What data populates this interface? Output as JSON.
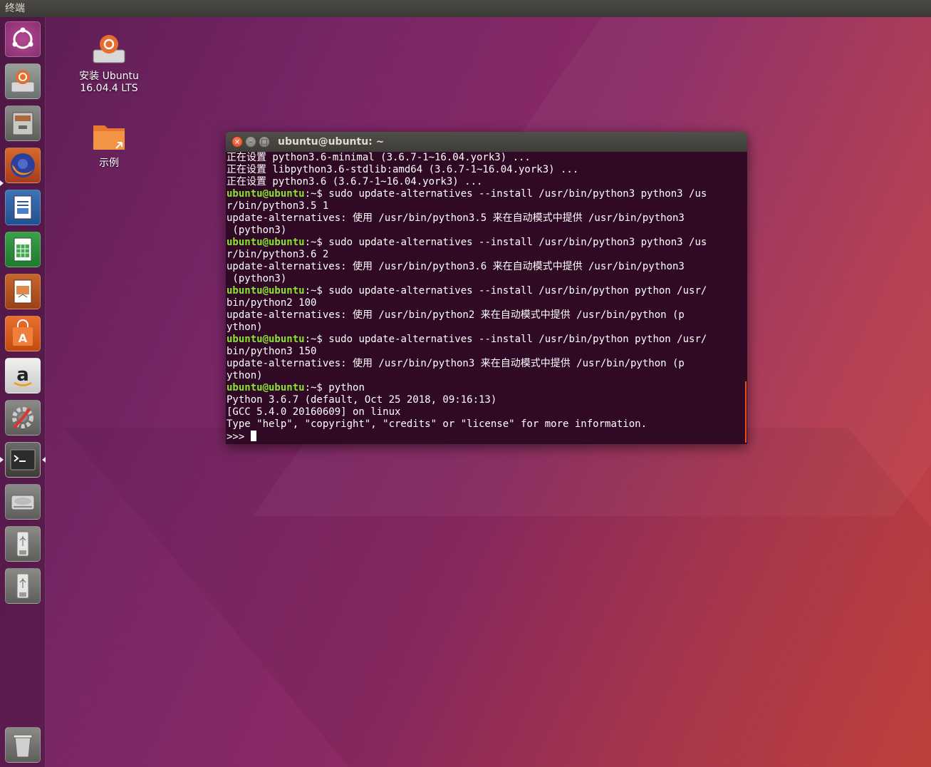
{
  "top_panel": {
    "title": "终端"
  },
  "launcher": {
    "items": [
      {
        "name": "dash"
      },
      {
        "name": "install-ubuntu"
      },
      {
        "name": "files"
      },
      {
        "name": "firefox"
      },
      {
        "name": "libreoffice-writer"
      },
      {
        "name": "libreoffice-calc"
      },
      {
        "name": "libreoffice-impress"
      },
      {
        "name": "ubuntu-software"
      },
      {
        "name": "amazon"
      },
      {
        "name": "system-settings"
      },
      {
        "name": "terminal"
      },
      {
        "name": "disk-drive"
      },
      {
        "name": "usb-drive-1"
      },
      {
        "name": "usb-drive-2"
      },
      {
        "name": "trash"
      }
    ]
  },
  "desktop": {
    "install_icon": {
      "label_line1": "安装 Ubuntu",
      "label_line2": "16.04.4 LTS"
    },
    "examples_icon": {
      "label": "示例"
    }
  },
  "terminal": {
    "title": "ubuntu@ubuntu: ~",
    "prompt": "ubuntu@ubuntu",
    "prompt_suffix": ":~$ ",
    "lines": [
      {
        "text": "正在设置 python3.6-minimal (3.6.7-1~16.04.york3) ..."
      },
      {
        "text": "正在设置 libpython3.6-stdlib:amd64 (3.6.7-1~16.04.york3) ..."
      },
      {
        "text": "正在设置 python3.6 (3.6.7-1~16.04.york3) ..."
      },
      {
        "prompt": true,
        "text": "sudo update-alternatives --install /usr/bin/python3 python3 /us"
      },
      {
        "text": "r/bin/python3.5 1"
      },
      {
        "text": "update-alternatives: 使用 /usr/bin/python3.5 来在自动模式中提供 /usr/bin/python3"
      },
      {
        "text": " (python3)"
      },
      {
        "prompt": true,
        "text": "sudo update-alternatives --install /usr/bin/python3 python3 /us"
      },
      {
        "text": "r/bin/python3.6 2"
      },
      {
        "text": "update-alternatives: 使用 /usr/bin/python3.6 来在自动模式中提供 /usr/bin/python3"
      },
      {
        "text": " (python3)"
      },
      {
        "prompt": true,
        "text": "sudo update-alternatives --install /usr/bin/python python /usr/"
      },
      {
        "text": "bin/python2 100"
      },
      {
        "text": "update-alternatives: 使用 /usr/bin/python2 来在自动模式中提供 /usr/bin/python (p"
      },
      {
        "text": "ython)"
      },
      {
        "prompt": true,
        "text": "sudo update-alternatives --install /usr/bin/python python /usr/"
      },
      {
        "text": "bin/python3 150"
      },
      {
        "text": "update-alternatives: 使用 /usr/bin/python3 来在自动模式中提供 /usr/bin/python (p"
      },
      {
        "text": "ython)"
      },
      {
        "prompt": true,
        "text": "python"
      },
      {
        "text": "Python 3.6.7 (default, Oct 25 2018, 09:16:13)"
      },
      {
        "text": "[GCC 5.4.0 20160609] on linux"
      },
      {
        "text": "Type \"help\", \"copyright\", \"credits\" or \"license\" for more information."
      }
    ],
    "repl_prompt": ">>> "
  },
  "colors": {
    "terminal_bg": "#300a24",
    "prompt_green": "#8ae234",
    "accent_orange": "#e95420"
  }
}
